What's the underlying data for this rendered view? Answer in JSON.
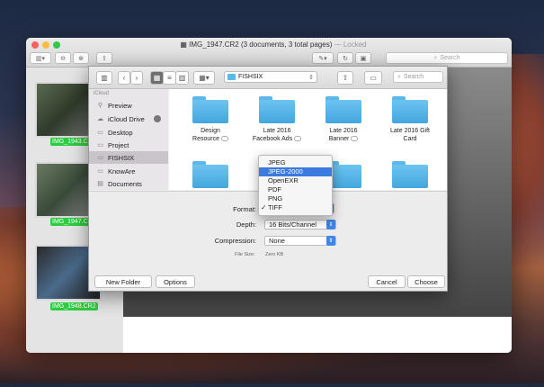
{
  "window": {
    "title": "IMG_1947.CR2 (3 documents, 3 total pages)",
    "title_suffix": "— Locked",
    "search_label": "Search"
  },
  "thumbnails": [
    {
      "label": "IMG_1943.CR"
    },
    {
      "label": "IMG_1947.CR"
    },
    {
      "label": "IMG_1948.CR2"
    }
  ],
  "dialog": {
    "path": "FISHSIX",
    "search_placeholder": "Search",
    "sidebar_header": "iCloud",
    "sidebar": [
      {
        "label": "Preview",
        "icon": "preview-icon"
      },
      {
        "label": "iCloud Drive",
        "icon": "cloud-icon"
      },
      {
        "label": "Desktop",
        "icon": "desktop-icon"
      },
      {
        "label": "Project",
        "icon": "folder-icon"
      },
      {
        "label": "FISHSIX",
        "icon": "folder-icon"
      },
      {
        "label": "KnowAre",
        "icon": "folder-icon"
      },
      {
        "label": "Documents",
        "icon": "documents-icon"
      }
    ],
    "folders_row1": [
      {
        "line1": "Design",
        "line2": "Resource"
      },
      {
        "line1": "Late 2016",
        "line2": "Facebook Ads"
      },
      {
        "line1": "Late 2016",
        "line2": "Banner"
      },
      {
        "line1": "Late 2016 Gift",
        "line2": "Card"
      }
    ],
    "format_label": "Format:",
    "depth_label": "Depth:",
    "depth_value": "16 Bits/Channel",
    "compression_label": "Compression:",
    "compression_value": "None",
    "filesize_label": "File Size:",
    "filesize_value": "Zero KB",
    "new_folder": "New Folder",
    "options": "Options",
    "cancel": "Cancel",
    "choose": "Choose"
  },
  "format_menu": {
    "items": [
      "JPEG",
      "JPEG-2000",
      "OpenEXR",
      "PDF",
      "PNG",
      "TIFF"
    ],
    "highlighted": "JPEG-2000",
    "checked": "TIFF",
    "check_mark": "✓"
  },
  "colors": {
    "accent": "#3b7be0",
    "folder": "#5cb8ea",
    "thumb_label": "#2ecc40"
  }
}
